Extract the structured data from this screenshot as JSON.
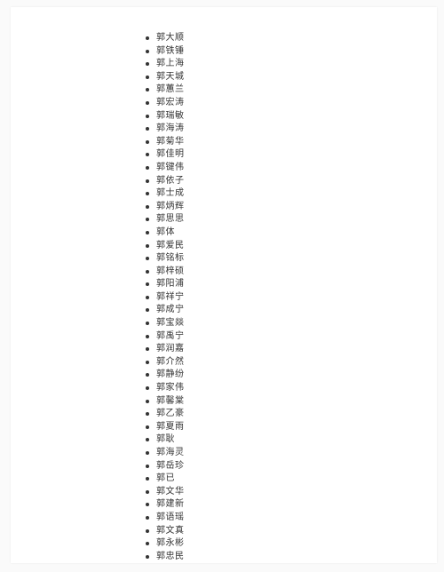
{
  "names": [
    "郭大顺",
    "郭铁锤",
    "郭上海",
    "郭天城",
    "郭蕙兰",
    "郭宏涛",
    "郭瑞敏",
    "郭海涛",
    "郭菊华",
    "郭佳明",
    "郭键伟",
    "郭依子",
    "郭士成",
    "郭炳辉",
    "郭思思",
    "郭体",
    "郭爱民",
    "郭铭标",
    "郭梓硕",
    "郭阳浦",
    "郭祥宁",
    "郭成宁",
    "郭宝燚",
    "郭禹宁",
    "郭润嘉",
    "郭介然",
    "郭静纷",
    "郭家伟",
    "郭馨棠",
    "郭乙豪",
    "郭夏雨",
    "郭耿",
    "郭海灵",
    "郭岳珍",
    "郭已",
    "郭文华",
    "郭建新",
    "郭语瑶",
    "郭文真",
    "郭永彬",
    "郭忠民"
  ]
}
